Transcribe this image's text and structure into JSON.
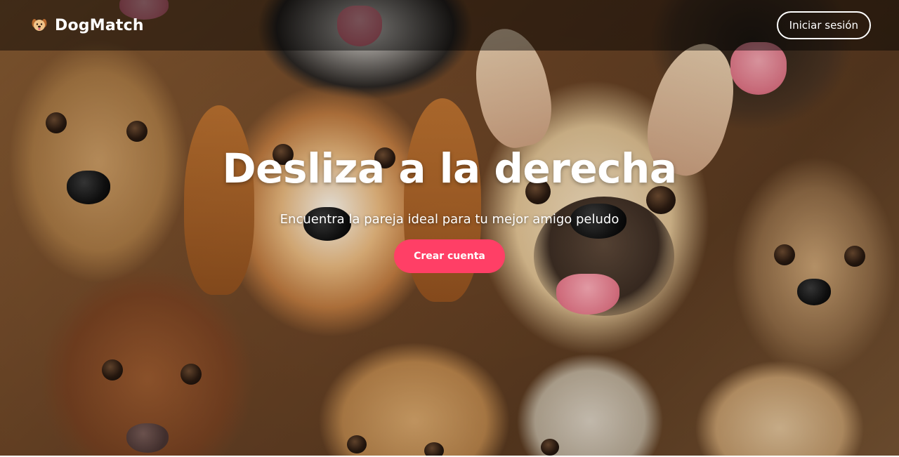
{
  "header": {
    "brand_icon": "dog-face-icon",
    "brand_name": "DogMatch",
    "login_label": "Iniciar sesión"
  },
  "hero": {
    "title": "Desliza a la derecha",
    "subtitle": "Encuentra la pareja ideal para tu mejor amigo peludo",
    "cta_label": "Crear cuenta",
    "background": "dogs-collage-photo"
  },
  "colors": {
    "accent": "#ff3f66",
    "header_overlay": "rgba(0,0,0,0.45)",
    "text": "#ffffff"
  }
}
